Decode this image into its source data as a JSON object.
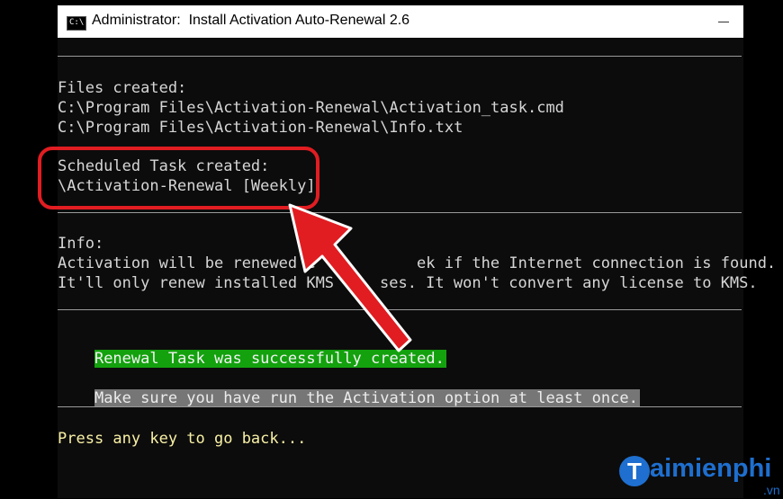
{
  "window": {
    "title": "Administrator:  Install Activation Auto-Renewal 2.6",
    "icon_glyph": "C:\\"
  },
  "console": {
    "files_header": "Files created:",
    "file_1": "C:\\Program Files\\Activation-Renewal\\Activation_task.cmd",
    "file_2": "C:\\Program Files\\Activation-Renewal\\Info.txt",
    "task_header": "Scheduled Task created:",
    "task_name": "\\Activation-Renewal [Weekly]",
    "info_header": "Info:",
    "info_1_a": "Activation will be renewed e",
    "info_1_b": "ek if the Internet connection is found.",
    "info_2_a": "It'll only renew installed KMS li",
    "info_2_b": "ses. It won't convert any license to KMS.",
    "success_msg": "Renewal Task was successfully created.",
    "reminder_msg": "Make sure you have run the Activation option at least once.",
    "prompt": "Press any key to go back..."
  },
  "watermark": {
    "logo_letter": "T",
    "text": "aimienphi",
    "suffix": ".vn"
  },
  "colors": {
    "terminal_bg": "#0c0c0c",
    "success_bg": "#13a10e",
    "reminder_bg": "#767676",
    "prompt_fg": "#f9f1a5",
    "annotation_red": "#e11d22",
    "watermark_blue": "#1e6fcf"
  }
}
